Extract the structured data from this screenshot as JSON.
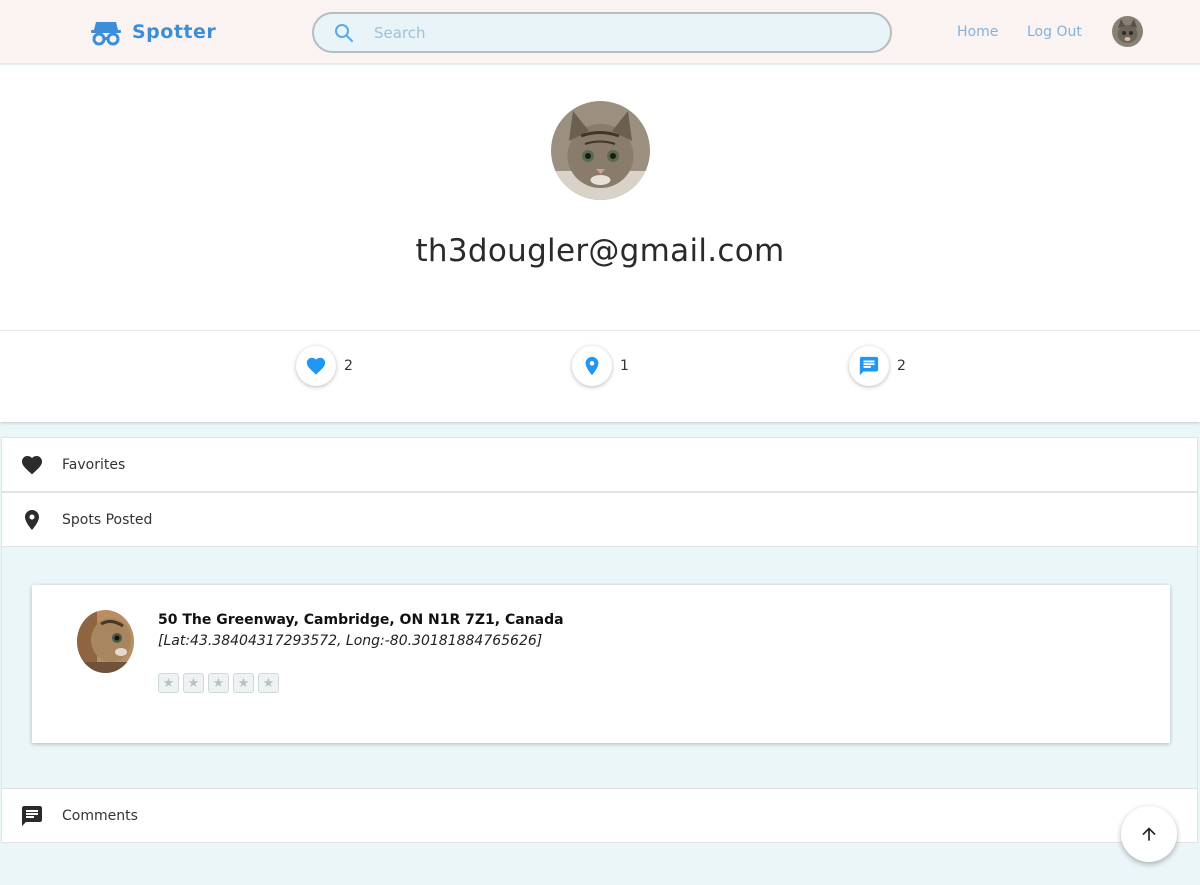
{
  "header": {
    "logo_text": "Spotter",
    "logo_icon": "spy-glasses-icon",
    "search_placeholder": "Search",
    "search_value": "",
    "nav": {
      "home": "Home",
      "logout": "Log Out"
    }
  },
  "profile": {
    "email": "th3dougler@gmail.com",
    "stats": {
      "favorites": "2",
      "spots": "1",
      "comments": "2"
    }
  },
  "sections": {
    "favorites": "Favorites",
    "spots_posted": "Spots Posted",
    "comments": "Comments"
  },
  "spots": [
    {
      "address": "50 The Greenway, Cambridge, ON N1R 7Z1, Canada",
      "coords": "[Lat:43.38404317293572, Long:-80.30181884765626]",
      "rating": 0,
      "rating_max": 5
    }
  ],
  "colors": {
    "brand": "#3d8ed8",
    "accent_icon": "#2196f3",
    "header_bg": "#fbf3f1",
    "page_bg": "#ebf6f8"
  }
}
